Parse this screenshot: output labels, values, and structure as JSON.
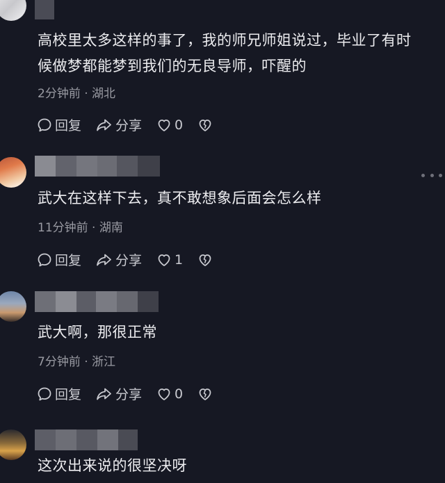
{
  "comments": [
    {
      "text_lines": [
        "高校里太多这样的事了，我的师兄师姐说过，毕业了有时",
        "候做梦都能梦到我们的无良导师，吓醒的"
      ],
      "meta": "2分钟前 · 湖北",
      "reply_label": "回复",
      "share_label": "分享",
      "like_count": "0"
    },
    {
      "text_lines": [
        "武大在这样下去，真不敢想象后面会怎么样"
      ],
      "meta": "11分钟前 · 湖南",
      "reply_label": "回复",
      "share_label": "分享",
      "like_count": "1"
    },
    {
      "text_lines": [
        "武大啊，那很正常"
      ],
      "meta": "7分钟前 · 浙江",
      "reply_label": "回复",
      "share_label": "分享",
      "like_count": "0"
    },
    {
      "text_lines": [
        "这次出来说的很坚决呀"
      ]
    }
  ],
  "icons": {
    "reply": "comment-bubble-icon",
    "share": "share-arrow-icon",
    "like": "heart-icon",
    "dislike": "broken-heart-icon",
    "more": "more-dots-icon"
  },
  "colors": {
    "background": "#161823",
    "text": "#ececef",
    "meta": "#9a9ba3"
  }
}
